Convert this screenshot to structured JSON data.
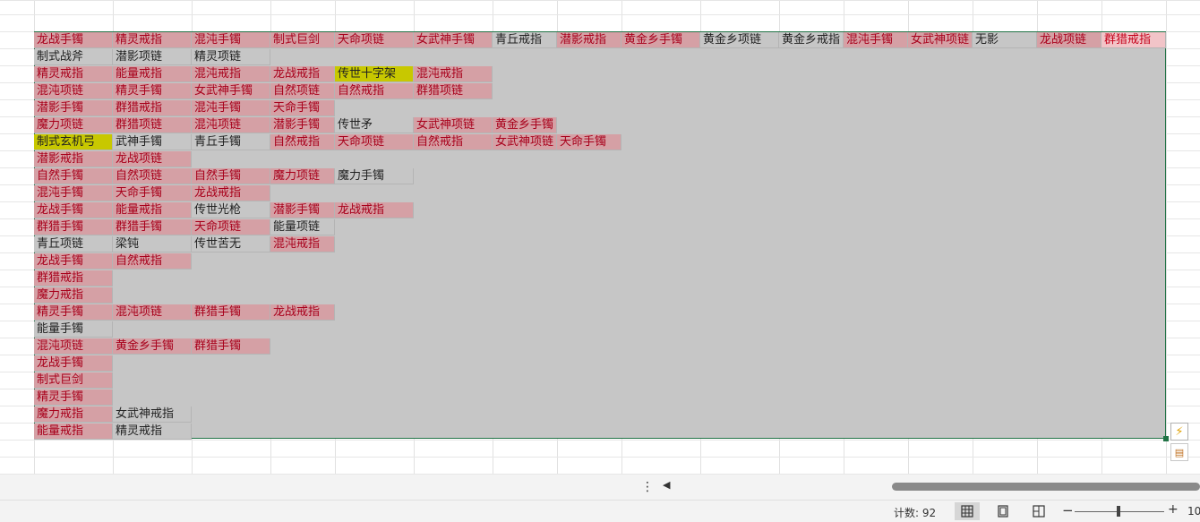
{
  "grid": {
    "rows": [
      [
        {
          "t": "龙战手镯",
          "s": "pink"
        },
        {
          "t": "精灵戒指",
          "s": "pink"
        },
        {
          "t": "混沌手镯",
          "s": "pink"
        },
        {
          "t": "制式巨剑",
          "s": "pink"
        },
        {
          "t": "天命项链",
          "s": "pink"
        },
        {
          "t": "女武神手镯",
          "s": "pink"
        },
        {
          "t": "青丘戒指",
          "s": "plain"
        },
        {
          "t": "潜影戒指",
          "s": "pink"
        },
        {
          "t": "黄金乡手镯",
          "s": "pink"
        },
        {
          "t": "黄金乡项链",
          "s": "plain"
        },
        {
          "t": "黄金乡戒指",
          "s": "plain"
        },
        {
          "t": "混沌手镯",
          "s": "pink"
        },
        {
          "t": "女武神项链",
          "s": "pink"
        },
        {
          "t": "无影",
          "s": "plain"
        },
        {
          "t": "龙战项链",
          "s": "pink"
        },
        {
          "t": "群猎戒指",
          "s": "pink2"
        }
      ],
      [
        {
          "t": "制式战斧",
          "s": "plain"
        },
        {
          "t": "潜影项链",
          "s": "plain"
        },
        {
          "t": "精灵项链",
          "s": "plain"
        }
      ],
      [
        {
          "t": "精灵戒指",
          "s": "pink"
        },
        {
          "t": "能量戒指",
          "s": "pink"
        },
        {
          "t": "混沌戒指",
          "s": "pink"
        },
        {
          "t": "龙战戒指",
          "s": "pink"
        },
        {
          "t": "传世十字架",
          "s": "yellow"
        },
        {
          "t": "混沌戒指",
          "s": "pink"
        }
      ],
      [
        {
          "t": "混沌项链",
          "s": "pink"
        },
        {
          "t": "精灵手镯",
          "s": "pink"
        },
        {
          "t": "女武神手镯",
          "s": "pink"
        },
        {
          "t": "自然项链",
          "s": "pink"
        },
        {
          "t": "自然戒指",
          "s": "pink"
        },
        {
          "t": "群猎项链",
          "s": "pink"
        }
      ],
      [
        {
          "t": "潜影手镯",
          "s": "pink"
        },
        {
          "t": "群猎戒指",
          "s": "pink"
        },
        {
          "t": "混沌手镯",
          "s": "pink"
        },
        {
          "t": "天命手镯",
          "s": "pink"
        }
      ],
      [
        {
          "t": "魔力项链",
          "s": "pink"
        },
        {
          "t": "群猎项链",
          "s": "pink"
        },
        {
          "t": "混沌项链",
          "s": "pink"
        },
        {
          "t": "潜影手镯",
          "s": "pink"
        },
        {
          "t": "传世矛",
          "s": "plain"
        },
        {
          "t": "女武神项链",
          "s": "pink"
        },
        {
          "t": "黄金乡手镯",
          "s": "pink"
        }
      ],
      [
        {
          "t": "制式玄机弓",
          "s": "yellow"
        },
        {
          "t": "武神手镯",
          "s": "plain"
        },
        {
          "t": "青丘手镯",
          "s": "plain"
        },
        {
          "t": "自然戒指",
          "s": "pink"
        },
        {
          "t": "天命项链",
          "s": "pink"
        },
        {
          "t": "自然戒指",
          "s": "pink"
        },
        {
          "t": "女武神项链",
          "s": "pink"
        },
        {
          "t": "天命手镯",
          "s": "pink"
        }
      ],
      [
        {
          "t": "潜影戒指",
          "s": "pink"
        },
        {
          "t": "龙战项链",
          "s": "pink"
        }
      ],
      [
        {
          "t": "自然手镯",
          "s": "pink"
        },
        {
          "t": "自然项链",
          "s": "pink"
        },
        {
          "t": "自然手镯",
          "s": "pink"
        },
        {
          "t": "魔力项链",
          "s": "pink"
        },
        {
          "t": "魔力手镯",
          "s": "plain"
        }
      ],
      [
        {
          "t": "混沌手镯",
          "s": "pink"
        },
        {
          "t": "天命手镯",
          "s": "pink"
        },
        {
          "t": "龙战戒指",
          "s": "pink"
        }
      ],
      [
        {
          "t": "龙战手镯",
          "s": "pink"
        },
        {
          "t": "能量戒指",
          "s": "pink"
        },
        {
          "t": "传世光枪",
          "s": "plain"
        },
        {
          "t": "潜影手镯",
          "s": "pink"
        },
        {
          "t": "龙战戒指",
          "s": "pink"
        }
      ],
      [
        {
          "t": "群猎手镯",
          "s": "pink"
        },
        {
          "t": "群猎手镯",
          "s": "pink"
        },
        {
          "t": "天命项链",
          "s": "pink"
        },
        {
          "t": "能量项链",
          "s": "plain"
        }
      ],
      [
        {
          "t": "青丘项链",
          "s": "plain"
        },
        {
          "t": "梁钝",
          "s": "plain"
        },
        {
          "t": "传世苦无",
          "s": "plain"
        },
        {
          "t": "混沌戒指",
          "s": "pink"
        }
      ],
      [
        {
          "t": "龙战手镯",
          "s": "pink"
        },
        {
          "t": "自然戒指",
          "s": "pink"
        }
      ],
      [
        {
          "t": "群猎戒指",
          "s": "pink"
        }
      ],
      [
        {
          "t": "魔力戒指",
          "s": "pink"
        }
      ],
      [
        {
          "t": "精灵手镯",
          "s": "pink"
        },
        {
          "t": "混沌项链",
          "s": "pink"
        },
        {
          "t": "群猎手镯",
          "s": "pink"
        },
        {
          "t": "龙战戒指",
          "s": "pink"
        }
      ],
      [
        {
          "t": "能量手镯",
          "s": "plain"
        }
      ],
      [
        {
          "t": "混沌项链",
          "s": "pink"
        },
        {
          "t": "黄金乡手镯",
          "s": "pink"
        },
        {
          "t": "群猎手镯",
          "s": "pink"
        }
      ],
      [
        {
          "t": "龙战手镯",
          "s": "pink"
        }
      ],
      [
        {
          "t": "制式巨剑",
          "s": "pink"
        }
      ],
      [
        {
          "t": "精灵手镯",
          "s": "pink"
        }
      ],
      [
        {
          "t": "魔力戒指",
          "s": "pink"
        },
        {
          "t": "女武神戒指",
          "s": "plain"
        }
      ],
      [
        {
          "t": "能量戒指",
          "s": "pink"
        },
        {
          "t": "精灵戒指",
          "s": "plain"
        }
      ]
    ]
  },
  "status": {
    "count_label": "计数: 92",
    "zoom_minus": "−",
    "zoom_plus": "+",
    "zoom_value": "10"
  },
  "colors": {
    "selection_border": "#217346",
    "pink_fill": "#d5a0a5",
    "pink_text": "#a8001b",
    "yellow_fill": "#c8c800",
    "selection_fill": "#c6c6c6"
  },
  "icons": {
    "quick_analysis": "lightning-icon",
    "paste_options": "paste-options-icon",
    "normal_view": "grid-view-icon",
    "page_layout": "page-layout-icon",
    "page_break": "page-break-icon"
  }
}
